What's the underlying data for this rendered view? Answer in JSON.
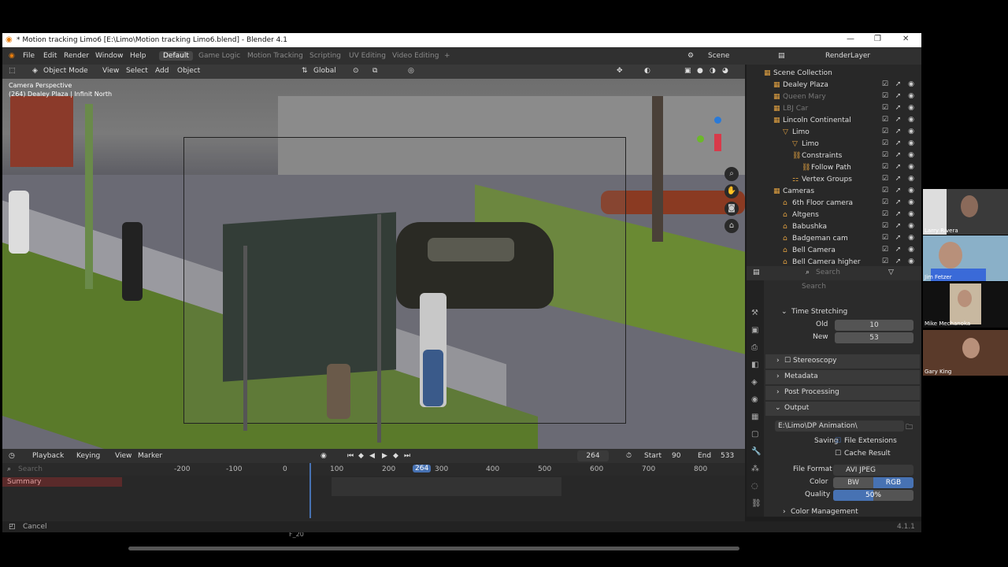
{
  "window": {
    "title": "* Motion tracking Limo6 [E:\\Limo\\Motion tracking Limo6.blend] - Blender 4.1"
  },
  "menubar": {
    "menus": [
      "File",
      "Edit",
      "Render",
      "Window",
      "Help"
    ],
    "workspaces": [
      "Default",
      "Game Logic",
      "Motion Tracking",
      "Scripting",
      "UV Editing",
      "Video Editing"
    ],
    "add_workspace": "+",
    "scene": "Scene",
    "view_layer": "RenderLayer"
  },
  "viewport": {
    "mode": "Object Mode",
    "menus": [
      "View",
      "Select",
      "Add",
      "Object"
    ],
    "orientation": "Global",
    "overlay_line1": "Camera Perspective",
    "overlay_line2": "(264) Dealey Plaza | Infinit North"
  },
  "outliner": {
    "rows": [
      {
        "label": "Scene Collection",
        "indent": 0,
        "dim": false
      },
      {
        "label": "Dealey Plaza",
        "indent": 1,
        "dim": false
      },
      {
        "label": "Queen Mary",
        "indent": 1,
        "dim": true
      },
      {
        "label": "LBJ Car",
        "indent": 1,
        "dim": true
      },
      {
        "label": "Lincoln Continental",
        "indent": 1,
        "dim": false
      },
      {
        "label": "Limo",
        "indent": 2,
        "dim": false
      },
      {
        "label": "Limo",
        "indent": 3,
        "dim": false
      },
      {
        "label": "Constraints",
        "indent": 3,
        "dim": false
      },
      {
        "label": "Follow Path",
        "indent": 4,
        "dim": false
      },
      {
        "label": "Vertex Groups",
        "indent": 3,
        "dim": false
      },
      {
        "label": "Cameras",
        "indent": 1,
        "dim": false
      },
      {
        "label": "6th Floor camera",
        "indent": 2,
        "dim": false
      },
      {
        "label": "Altgens",
        "indent": 2,
        "dim": false
      },
      {
        "label": "Babushka",
        "indent": 2,
        "dim": false
      },
      {
        "label": "Badgeman cam",
        "indent": 2,
        "dim": false
      },
      {
        "label": "Bell Camera",
        "indent": 2,
        "dim": false
      },
      {
        "label": "Bell Camera higher",
        "indent": 2,
        "dim": false
      }
    ]
  },
  "properties": {
    "search_placeholder": "Search",
    "time_stretching": "Time Stretching",
    "old_label": "Old",
    "old_value": "10",
    "new_label": "New",
    "new_value": "53",
    "stereoscopy": "Stereoscopy",
    "metadata": "Metadata",
    "post_processing": "Post Processing",
    "output": "Output",
    "output_path": "E:\\Limo\\DP Animation\\",
    "saving_label": "Saving",
    "file_extensions": "File Extensions",
    "cache_result": "Cache Result",
    "file_format_label": "File Format",
    "file_format": "AVI JPEG",
    "color_label": "Color",
    "color_bw": "BW",
    "color_rgb": "RGB",
    "quality_label": "Quality",
    "quality": "50%",
    "color_management": "Color Management"
  },
  "timeline": {
    "menus": [
      "Playback",
      "Keying",
      "View",
      "Marker"
    ],
    "current_frame": "264",
    "start_label": "Start",
    "start": "90",
    "end_label": "End",
    "end": "533",
    "search_placeholder": "Search",
    "summary": "Summary",
    "ticks": [
      "-200",
      "-100",
      "0",
      "100",
      "200",
      "264",
      "300",
      "400",
      "500",
      "600",
      "700",
      "800"
    ],
    "marker": "F_20"
  },
  "statusbar": {
    "left": "Cancel",
    "version": "4.1.1"
  },
  "video_call": {
    "participants": [
      "Larry Rivera",
      "Jim Fetzer",
      "Mike Mechanoka",
      "Gary King"
    ]
  }
}
